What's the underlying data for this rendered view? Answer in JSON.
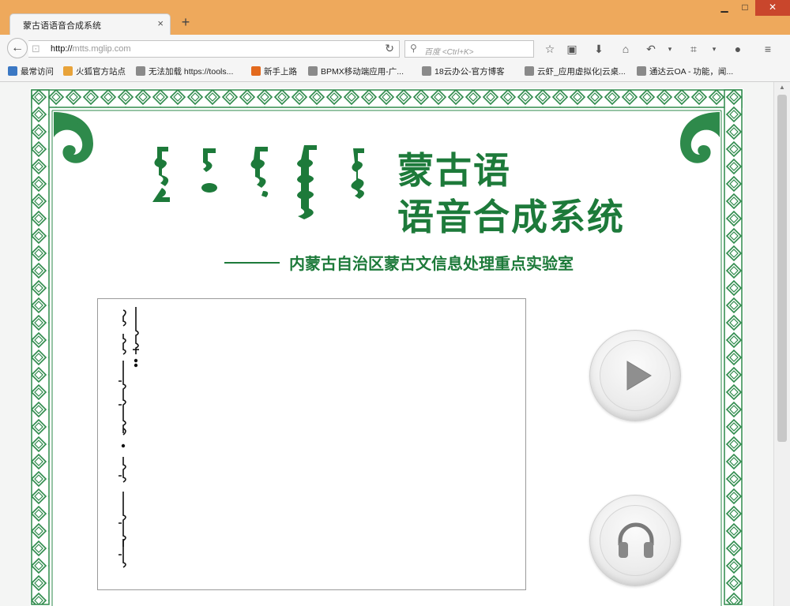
{
  "browser": {
    "tab_title": "蒙古语语音合成系统",
    "tab_close": "×",
    "new_tab": "+",
    "win_min": "▁",
    "win_max": "□",
    "win_close": "✕",
    "url_scheme": "http://",
    "url_host": "mtts.mglip.com",
    "search_placeholder": "百度 <Ctrl+K>"
  },
  "bookmarks": [
    {
      "label": "最常访问",
      "color": "#3b78c4"
    },
    {
      "label": "火狐官方站点",
      "color": "#e8a33a"
    },
    {
      "label": "无法加载 https://tools...",
      "color": "#8a8a8a"
    },
    {
      "label": "新手上路",
      "color": "#e36a1e"
    },
    {
      "label": "BPMX移动端应用-广...",
      "color": "#8a8a8a"
    },
    {
      "label": "18云办公-官方博客",
      "color": "#8a8a8a"
    },
    {
      "label": "云虾_应用虚拟化|云桌...",
      "color": "#8a8a8a"
    },
    {
      "label": "通达云OA - 功能，闻...",
      "color": "#8a8a8a"
    }
  ],
  "page": {
    "title_line1": "蒙古语",
    "title_line2": "语音合成系统",
    "subtitle": "内蒙古自治区蒙古文信息处理重点实验室",
    "brand_color": "#1d7a3a"
  },
  "buttons": {
    "play_icon": "play-icon",
    "listen_icon": "headphones-icon"
  }
}
